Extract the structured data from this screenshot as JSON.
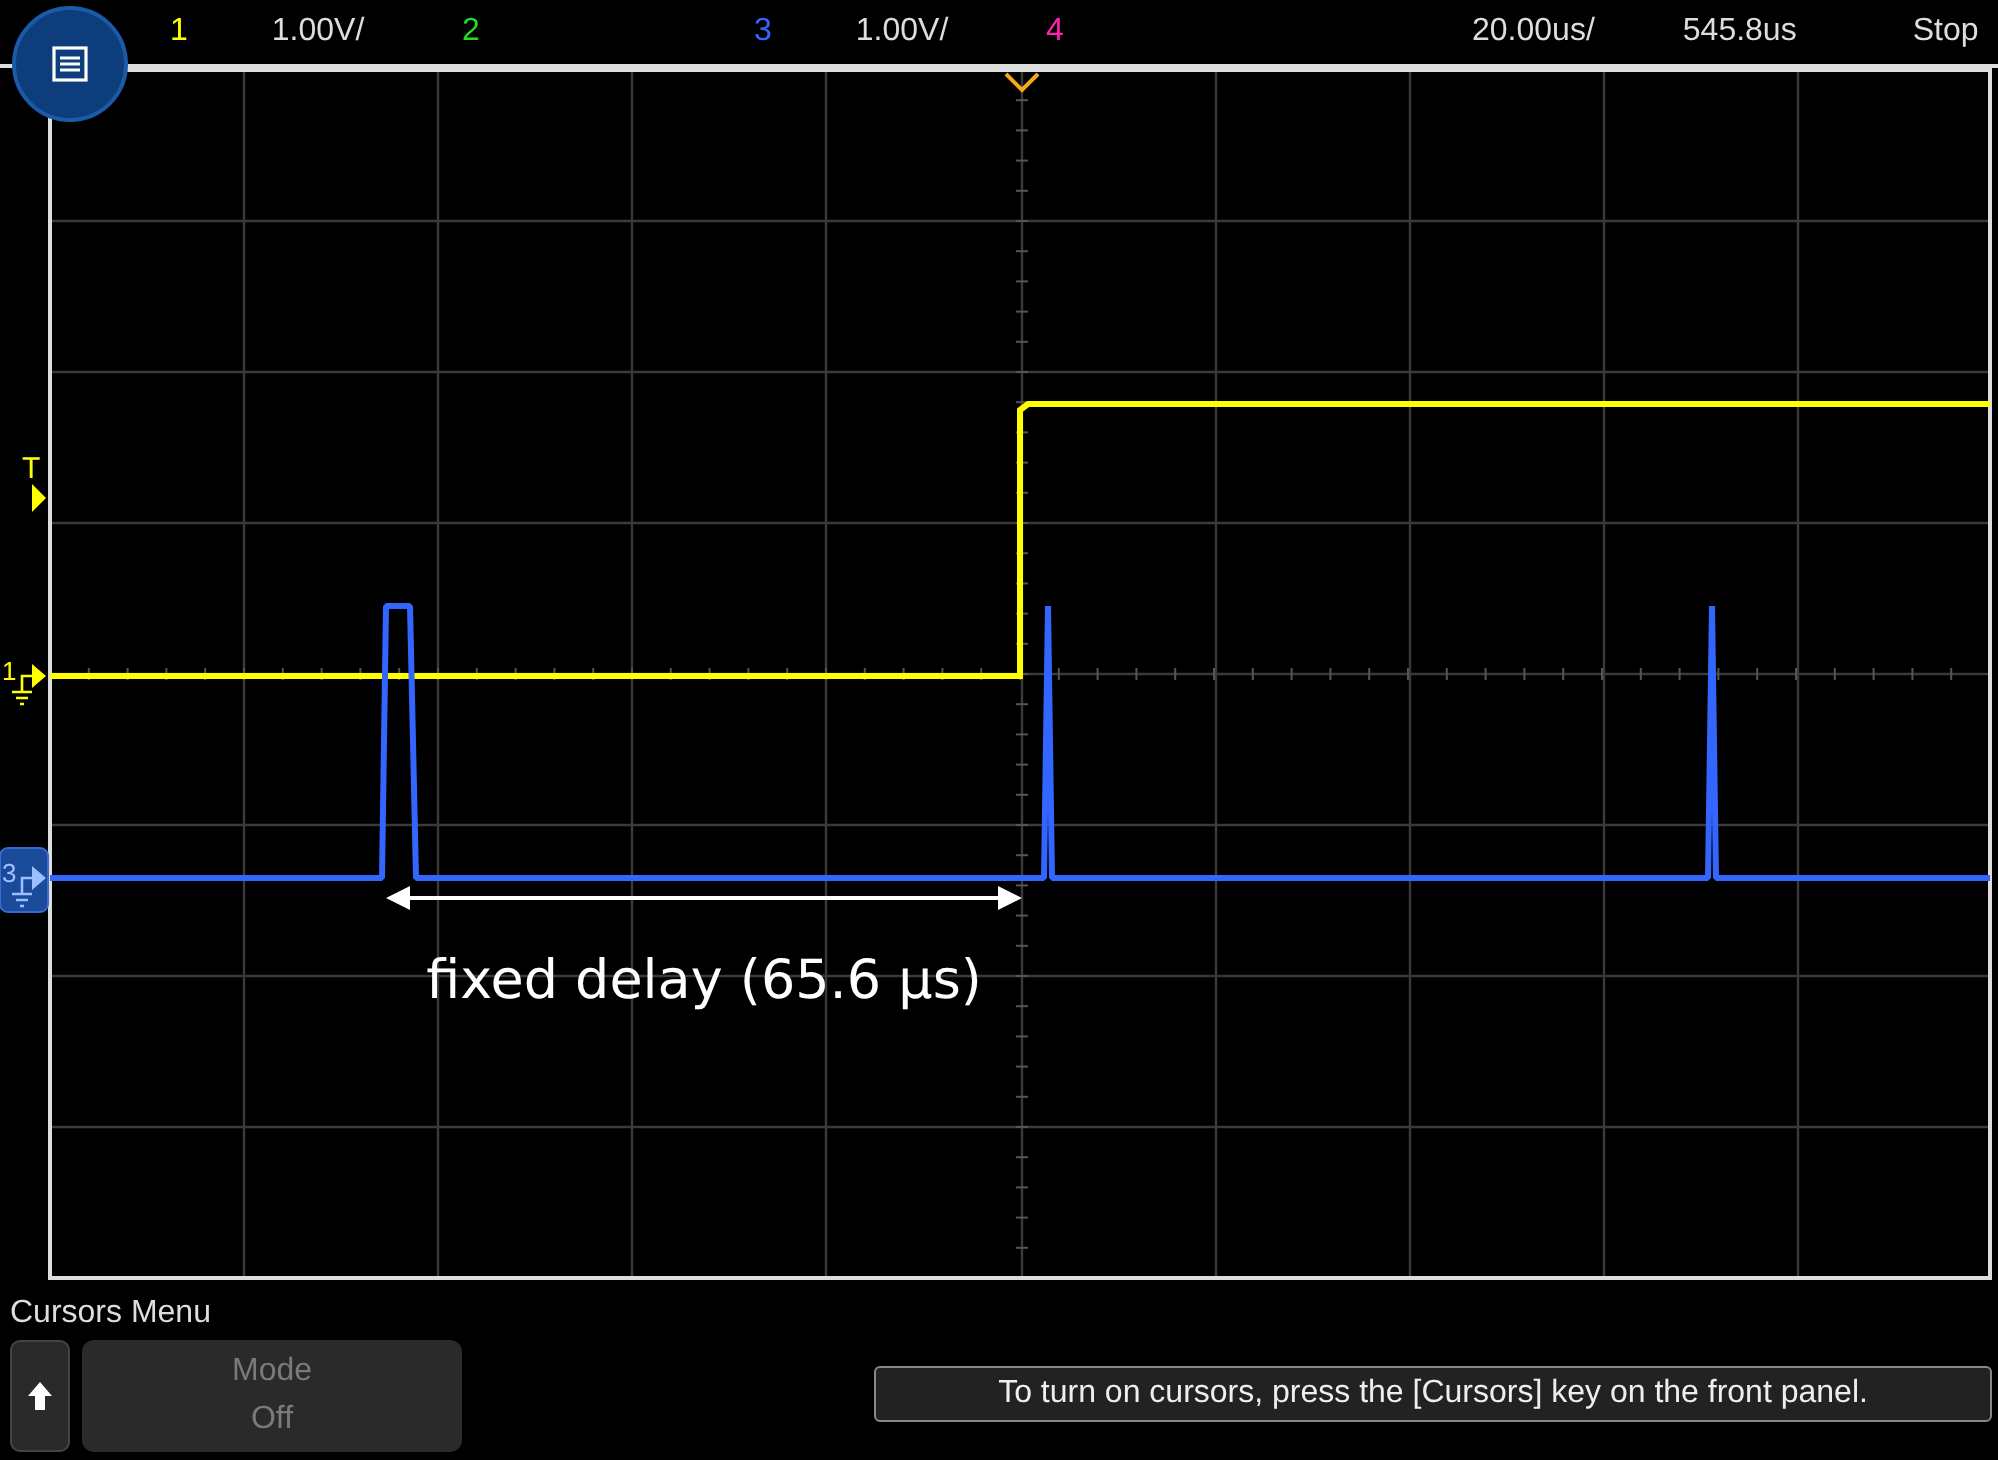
{
  "channels": [
    {
      "number": "1",
      "color": "#ffff00",
      "scale": "1.00V/"
    },
    {
      "number": "2",
      "color": "#22dd22"
    },
    {
      "number": "3",
      "color": "#3366ff",
      "scale": "1.00V/"
    },
    {
      "number": "4",
      "color": "#ff22aa"
    }
  ],
  "timebase": {
    "scale": "20.00us/",
    "delay": "545.8us",
    "status": "Stop"
  },
  "markers": [
    {
      "kind": "trigger",
      "label": "T",
      "color": "#ffff00"
    },
    {
      "kind": "ground",
      "label": "1",
      "color": "#ffff00",
      "selected": false
    },
    {
      "kind": "ground",
      "label": "3",
      "color": "#9cc0ff",
      "selected": true
    }
  ],
  "annotation": "fixed delay (65.6 µs)",
  "menu": {
    "title": "Cursors Menu",
    "softkeys": [
      {
        "label": "Mode",
        "value": "Off",
        "disabled": true
      }
    ],
    "message": "To turn on cursors, press the [Cursors] key on the front panel."
  }
}
